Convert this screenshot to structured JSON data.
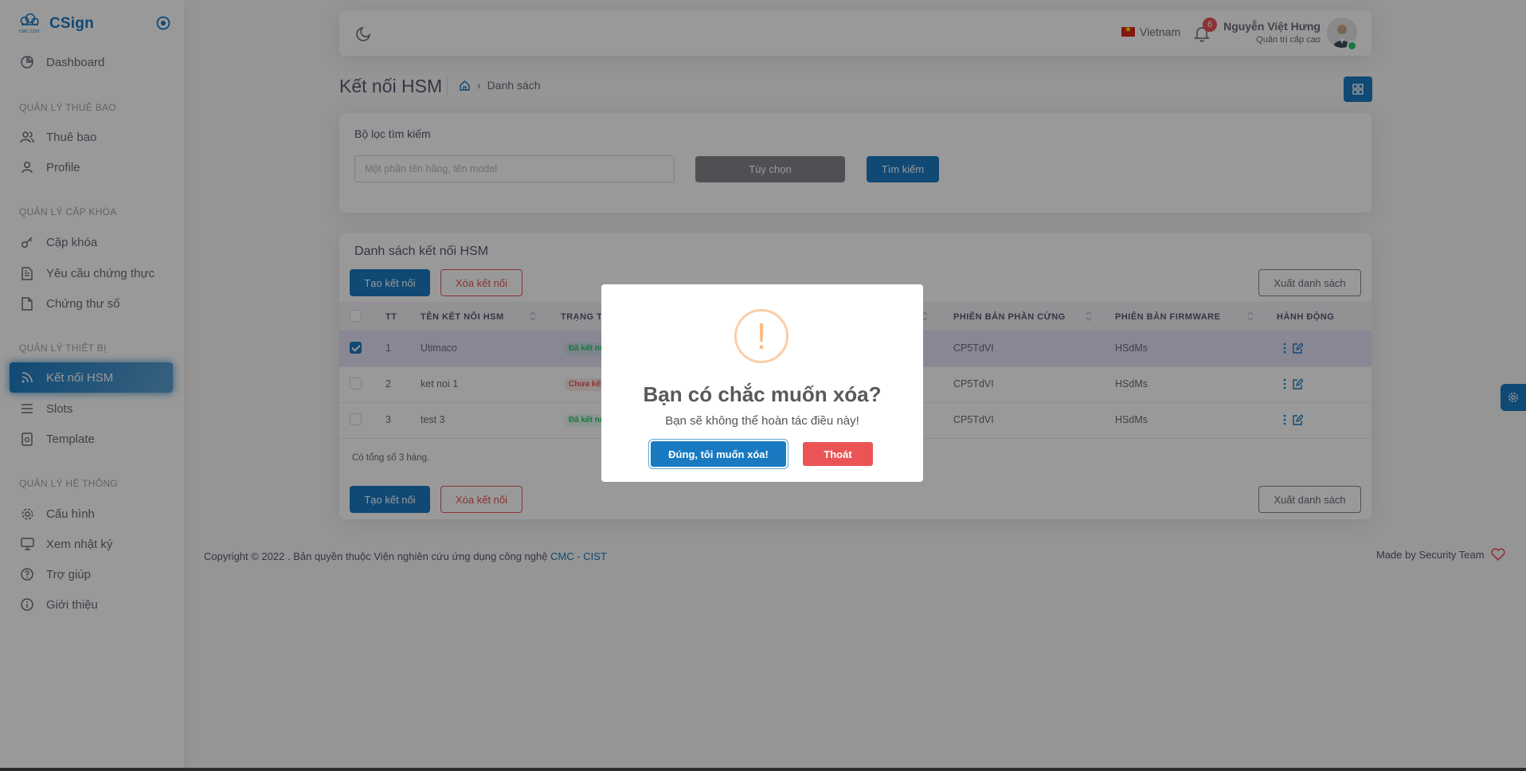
{
  "app": {
    "name": "CSign",
    "logo_text": "CMC CIST"
  },
  "sidebar": {
    "dashboard": "Dashboard",
    "sections": {
      "subscribers": "QUẢN LÝ THUÊ BAO",
      "keys": "QUẢN LÝ CẶP KHÓA",
      "devices": "QUẢN LÝ THIẾT BỊ",
      "system": "QUẢN LÝ HỆ THỐNG"
    },
    "items": {
      "subscriber": "Thuê bao",
      "profile": "Profile",
      "keypair": "Cặp khóa",
      "cert_request": "Yêu cầu chứng thực",
      "certificate": "Chứng thư số",
      "hsm": "Kết nối HSM",
      "slots": "Slots",
      "template": "Template",
      "config": "Cấu hình",
      "logs": "Xem nhật ký",
      "help": "Trợ giúp",
      "about": "Giới thiệu"
    }
  },
  "header": {
    "language": "Vietnam",
    "notification_count": "6",
    "user_name": "Nguyễn Việt Hưng",
    "user_role": "Quản trị cấp cao"
  },
  "page": {
    "title": "Kết nối HSM",
    "breadcrumb_current": "Danh sách"
  },
  "filter": {
    "title": "Bộ lọc tìm kiếm",
    "placeholder": "Một phần tên hãng, tên model",
    "options_label": "Tùy chọn",
    "search_label": "Tìm kiếm"
  },
  "list": {
    "title": "Danh sách kết nối HSM",
    "create_label": "Tạo kết nối",
    "delete_label": "Xóa kết nối",
    "export_label": "Xuất danh sách",
    "columns": {
      "index": "TT",
      "name": "TÊN KẾT NỐI HSM",
      "status": "TRẠNG T",
      "hardware": "PHIÊN BẢN PHẦN CỨNG",
      "firmware": "PHIÊN BẢN FIRMWARE",
      "actions": "HÀNH ĐỘNG"
    },
    "rows": [
      {
        "index": "1",
        "name": "Utimaco",
        "status": "Đã kết nố",
        "hardware": "CP5TdVI",
        "firmware": "HSdMs"
      },
      {
        "index": "2",
        "name": "ket noi 1",
        "status": "Chưa kết",
        "hardware": "CP5TdVI",
        "firmware": "HSdMs"
      },
      {
        "index": "3",
        "name": "test 3",
        "status": "Đã kết nố",
        "hardware": "CP5TdVI",
        "firmware": "HSdMs"
      }
    ],
    "total": "Có tổng số 3 hàng."
  },
  "footer": {
    "copyright": "Copyright © 2022 . Bản quyền thuộc Viện nghiên cứu ứng dụng công nghệ ",
    "org_link": "CMC - CIST",
    "made_by": "Made by Security Team"
  },
  "modal": {
    "icon": "!",
    "title": "Bạn có chắc muốn xóa?",
    "text": "Bạn sẽ không thể hoàn tác điều này!",
    "confirm_label": "Đúng, tôi muốn xóa!",
    "cancel_label": "Thoát"
  },
  "colors": {
    "primary": "#1a7ac1",
    "danger": "#ea5455",
    "success": "#28c76f",
    "warning_icon": "#f8bb86"
  }
}
